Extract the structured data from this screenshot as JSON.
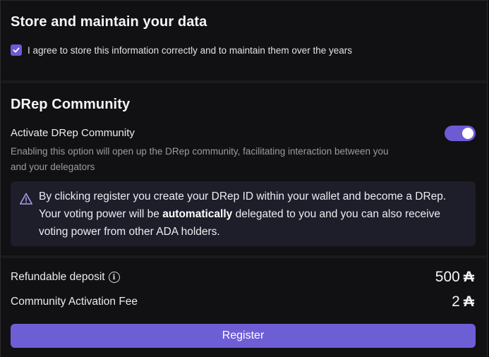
{
  "store_section": {
    "title": "Store and maintain your data",
    "agree_text": "I agree to store this information correctly and to maintain them over the years",
    "agree_checked": true
  },
  "community_section": {
    "title": "DRep Community",
    "toggle_label": "Activate DRep Community",
    "toggle_description": "Enabling this option will open up the DRep community, facilitating interaction between you and your delegators",
    "toggle_on": true,
    "notice": {
      "part1": "By clicking register you create your DRep ID within your wallet and become a DRep. Your voting power will be ",
      "bold": "automatically",
      "part2": " delegated to you and you can also receive voting power from other ADA holders."
    }
  },
  "fees": {
    "refundable_label": "Refundable deposit",
    "refundable_value": "500",
    "activation_label": "Community Activation Fee",
    "activation_value": "2",
    "currency_symbol": "₳"
  },
  "register_label": "Register",
  "colors": {
    "accent": "#6e5ed6",
    "notice_bg": "#1e1e2a",
    "background": "#111113"
  },
  "icons": {
    "checkbox": "check-icon",
    "notice": "warning-triangle-icon",
    "info": "info-circle-icon",
    "currency": "ada-icon"
  }
}
